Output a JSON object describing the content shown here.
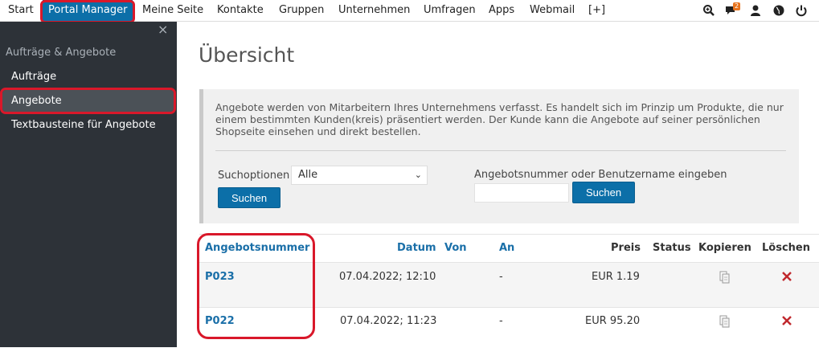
{
  "topnav": {
    "items": [
      "Start",
      "Portal Manager",
      "Meine Seite",
      "Kontakte",
      "Gruppen",
      "Unternehmen",
      "Umfragen",
      "Apps",
      "Webmail",
      "[+]"
    ],
    "notification_count": "2",
    "icons": [
      "zoom-icon",
      "chat-icon",
      "user-icon",
      "globe-icon",
      "power-icon"
    ]
  },
  "sidebar": {
    "close": "×",
    "heading": "Aufträge & Angebote",
    "items": [
      "Aufträge",
      "Angebote",
      "Textbausteine für Angebote"
    ]
  },
  "main": {
    "title": "Übersicht",
    "info": "Angebote werden von Mitarbeitern Ihres Unternehmens verfasst. Es handelt sich im Prinzip um Produkte, die nur einem bestimmten Kunden(kreis) präsentiert werden. Der Kunde kann die Angebote auf seiner persönlichen Shopseite einsehen und direkt bestellen.",
    "search": {
      "options_label": "Suchoptionen",
      "select_value": "Alle",
      "button1": "Suchen",
      "number_label": "Angebotsnummer oder Benutzername eingeben",
      "number_value": "",
      "button2": "Suchen"
    },
    "table": {
      "headers": [
        "Angebotsnummer",
        "Datum",
        "Von",
        "An",
        "Preis",
        "Status",
        "Kopieren",
        "Löschen"
      ],
      "rows": [
        {
          "nummer": "P023",
          "datum": "07.04.2022; 12:10",
          "von": "",
          "an": "-",
          "preis": "EUR 1.19",
          "status": ""
        },
        {
          "nummer": "P022",
          "datum": "07.04.2022; 11:23",
          "von": "",
          "an": "-",
          "preis": "EUR 95.20",
          "status": ""
        }
      ]
    }
  },
  "colors": {
    "accent": "#0c6fa8",
    "sidebar": "#2d3238",
    "highlight": "#d9182a",
    "badge": "#e8741e"
  }
}
